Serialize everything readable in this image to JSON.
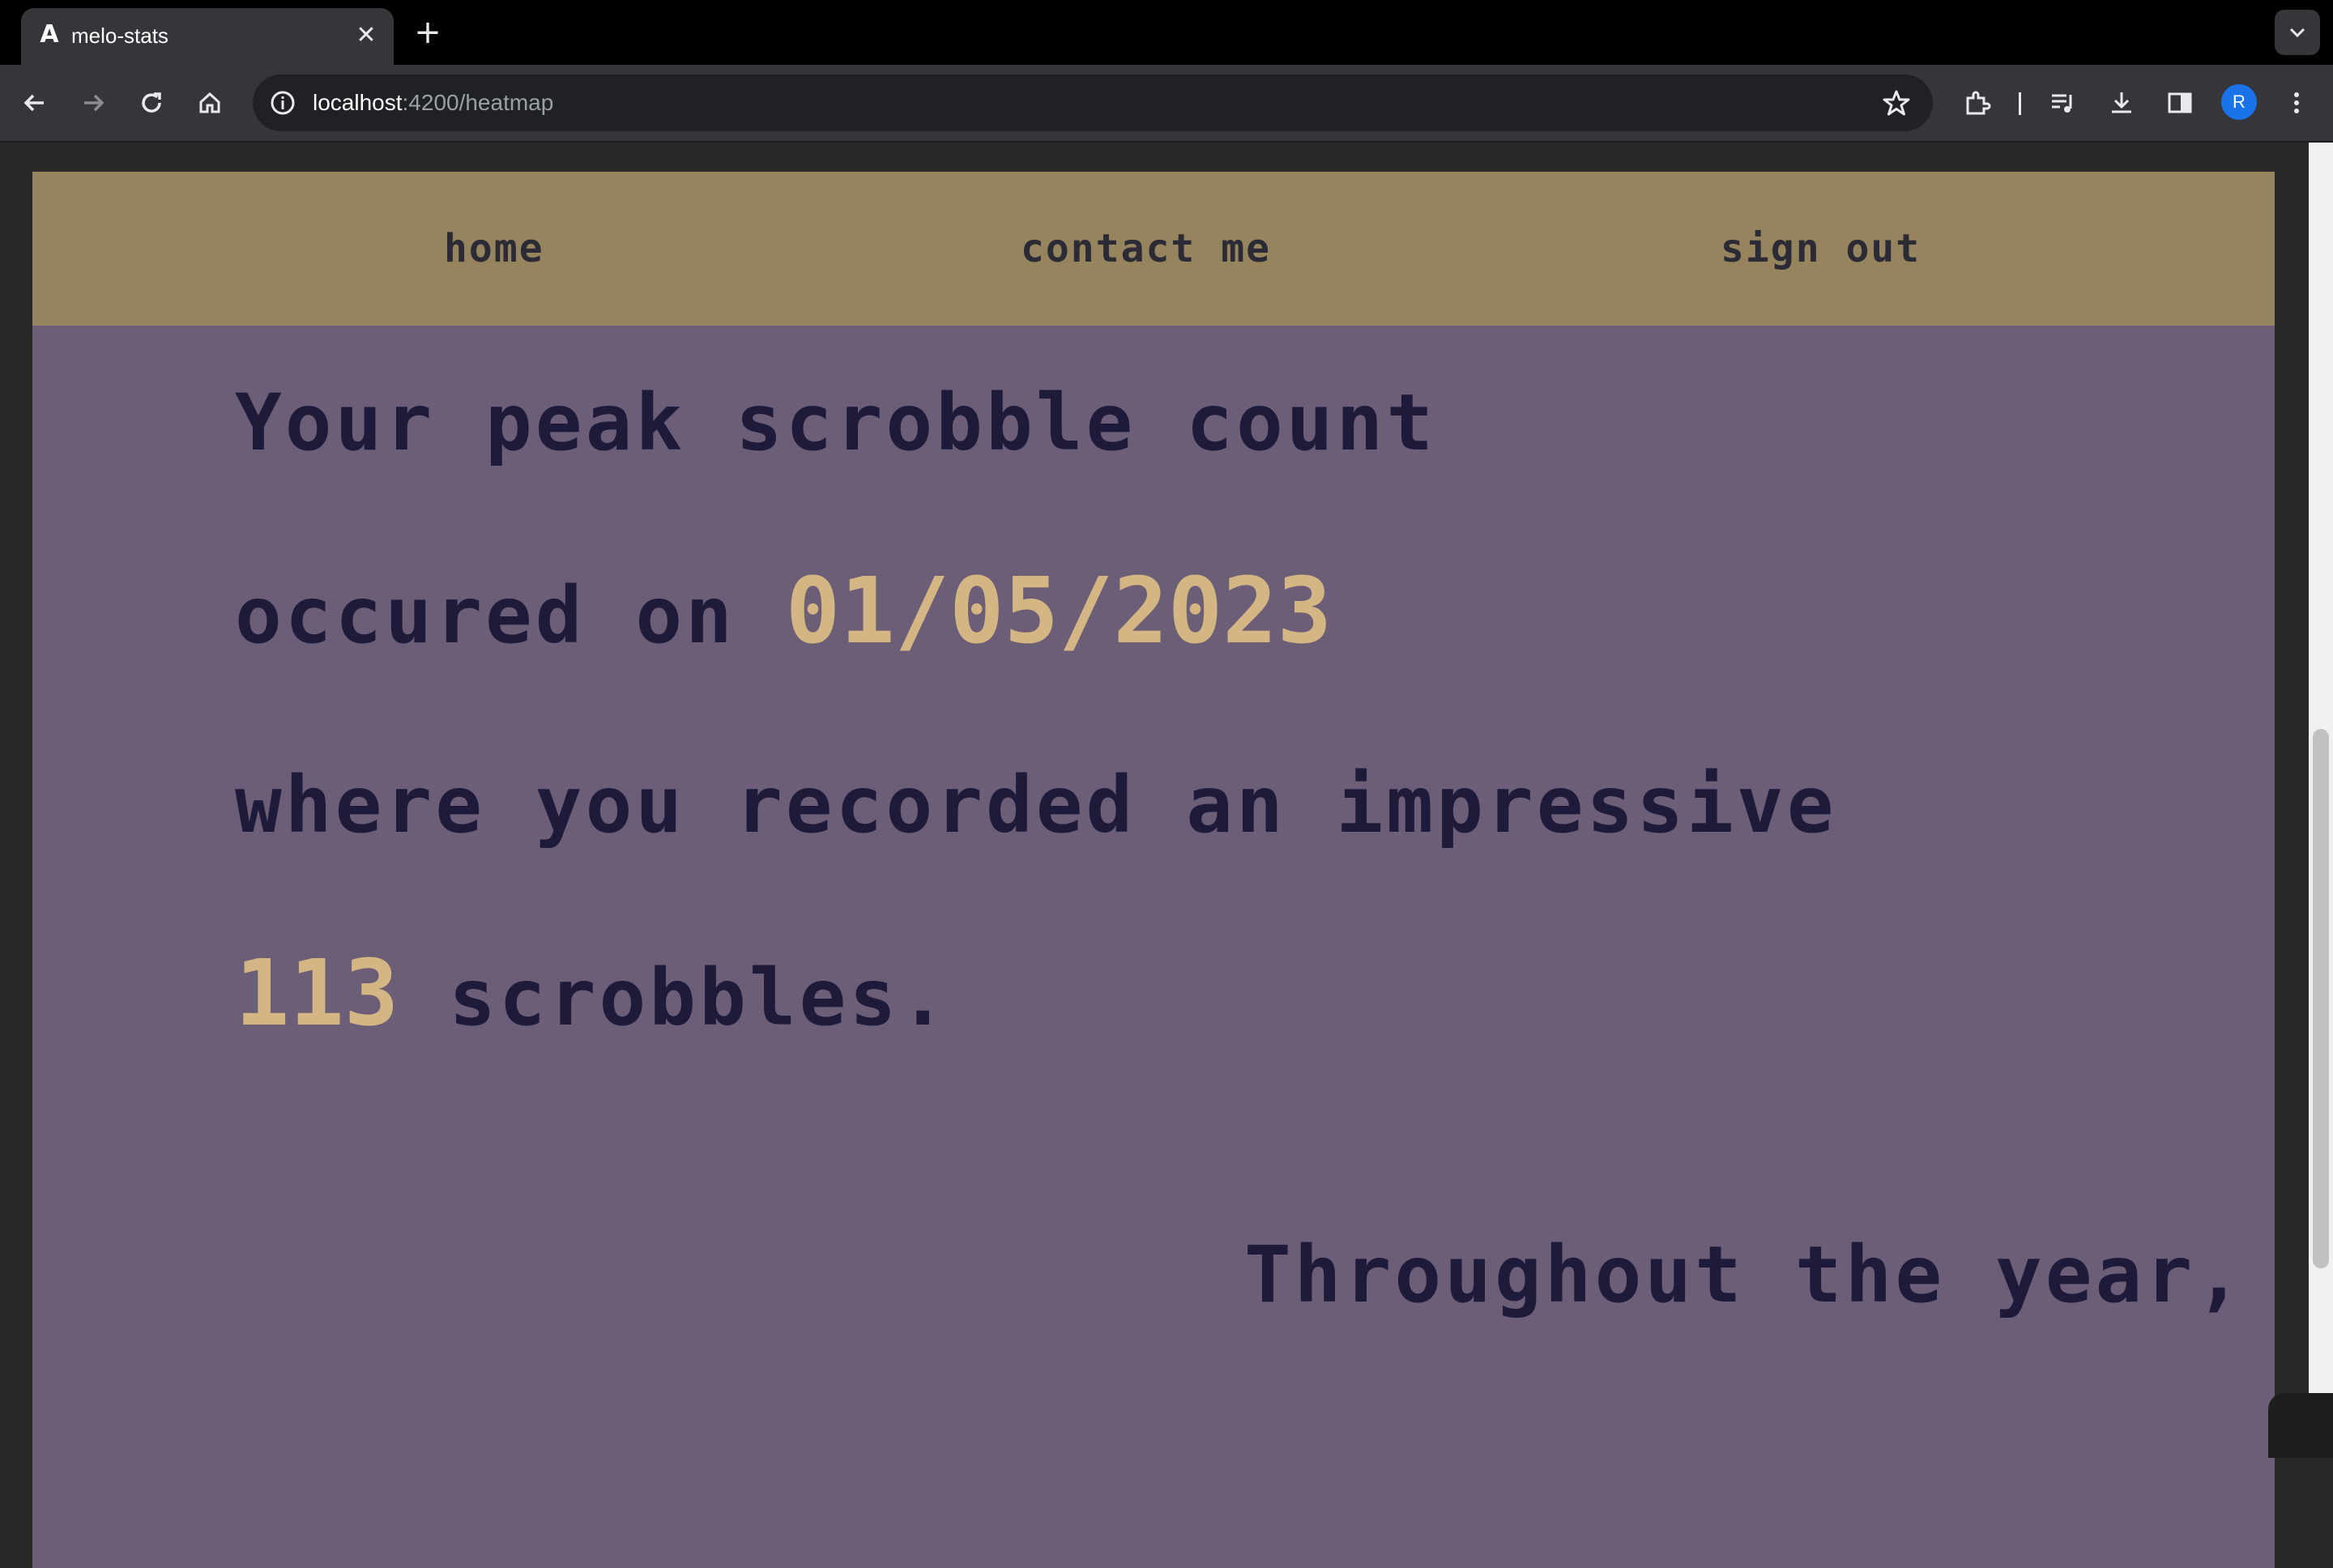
{
  "browser": {
    "tab": {
      "title": "melo-stats",
      "favicon": "angular-icon"
    },
    "address": {
      "host": "localhost",
      "path": ":4200/heatmap"
    },
    "profile_initial": "R"
  },
  "nav": {
    "home": "home",
    "contact": "contact me",
    "signout": "sign out"
  },
  "stats": {
    "line1": "Your peak scrobble count",
    "line2_prefix": "occured on ",
    "peak_date": "01/05/2023",
    "line3": "where you recorded an impressive",
    "peak_count": "113",
    "line4_suffix": " scrobbles.",
    "next_heading": "Throughout the year,"
  },
  "colors": {
    "nav_bg": "#95845e",
    "content_bg": "#6b5e76",
    "text": "#1e1a3a",
    "highlight": "#d3b684"
  }
}
